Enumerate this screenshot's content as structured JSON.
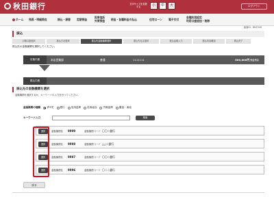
{
  "header": {
    "bank_name": "秋田銀行",
    "font_size_label": "文字サイズを変更する",
    "font_sizes": [
      "小",
      "中",
      "大"
    ],
    "logout_label": "ログアウト",
    "brand_color": "#b0303e"
  },
  "nav": {
    "items": [
      {
        "label": "ホーム",
        "icon": "home-icon"
      },
      {
        "label": "残高・明細照会"
      },
      {
        "label": "振込・振替"
      },
      {
        "label": "定期預金"
      },
      {
        "label_line1": "投資信託",
        "label_line2": "外貨預金"
      },
      {
        "label": "税金・各種料金の払込"
      },
      {
        "label": "住宅ローン"
      },
      {
        "label": "電子交付"
      },
      {
        "label_line1": "各種利用設定",
        "label_line2": "利用口座追加・削除"
      }
    ]
  },
  "date_line": "画面ID：BKIF006",
  "page_title": "振込",
  "steps": [
    "引落口座選択",
    "振込方法選択",
    "振込先金融機関選択",
    "振込先支店選択",
    "振込金額入力",
    "振込内容確認",
    "振込完了"
  ],
  "active_step": 2,
  "instruction": "振込先の金融機関を選択してください。",
  "source": {
    "label": "引落口座",
    "branch": "本店営業部",
    "type": "普通",
    "number": "1111111",
    "amount": "500,000円",
    "amount_suffix": "預金残高"
  },
  "destination": {
    "label": "振込口座"
  },
  "section": {
    "title": "振込先の金融機関を選択",
    "subtitle": "金融機関を選択するか、キーワードの入力を行ってください。"
  },
  "type_row": {
    "label": "金融機関の種類",
    "options": [
      "すべて",
      "銀行",
      "信用金庫",
      "信用組合",
      "労働金庫",
      "農協・漁協"
    ],
    "selected": 0
  },
  "keyword": {
    "label": "キーワード入力",
    "value": "",
    "placeholder": "",
    "button_label": "検索"
  },
  "results": [
    {
      "select_label": "選択",
      "name_label": "金融機関名",
      "code": "9999",
      "code_label": "金融機関コード",
      "bank": "〇〇二銀行"
    },
    {
      "select_label": "選択",
      "name_label": "金融機関名",
      "code": "9998",
      "code_label": "金融機関コード",
      "bank": "△△二銀行"
    },
    {
      "select_label": "選択",
      "name_label": "金融機関名",
      "code": "9997",
      "code_label": "金融機関コード",
      "bank": "〇〇二銀行"
    },
    {
      "select_label": "選択",
      "name_label": "金融機関名",
      "code": "9996",
      "code_label": "金融機関コード",
      "bank": "〇二二銀行"
    }
  ],
  "back_label": "戻る"
}
